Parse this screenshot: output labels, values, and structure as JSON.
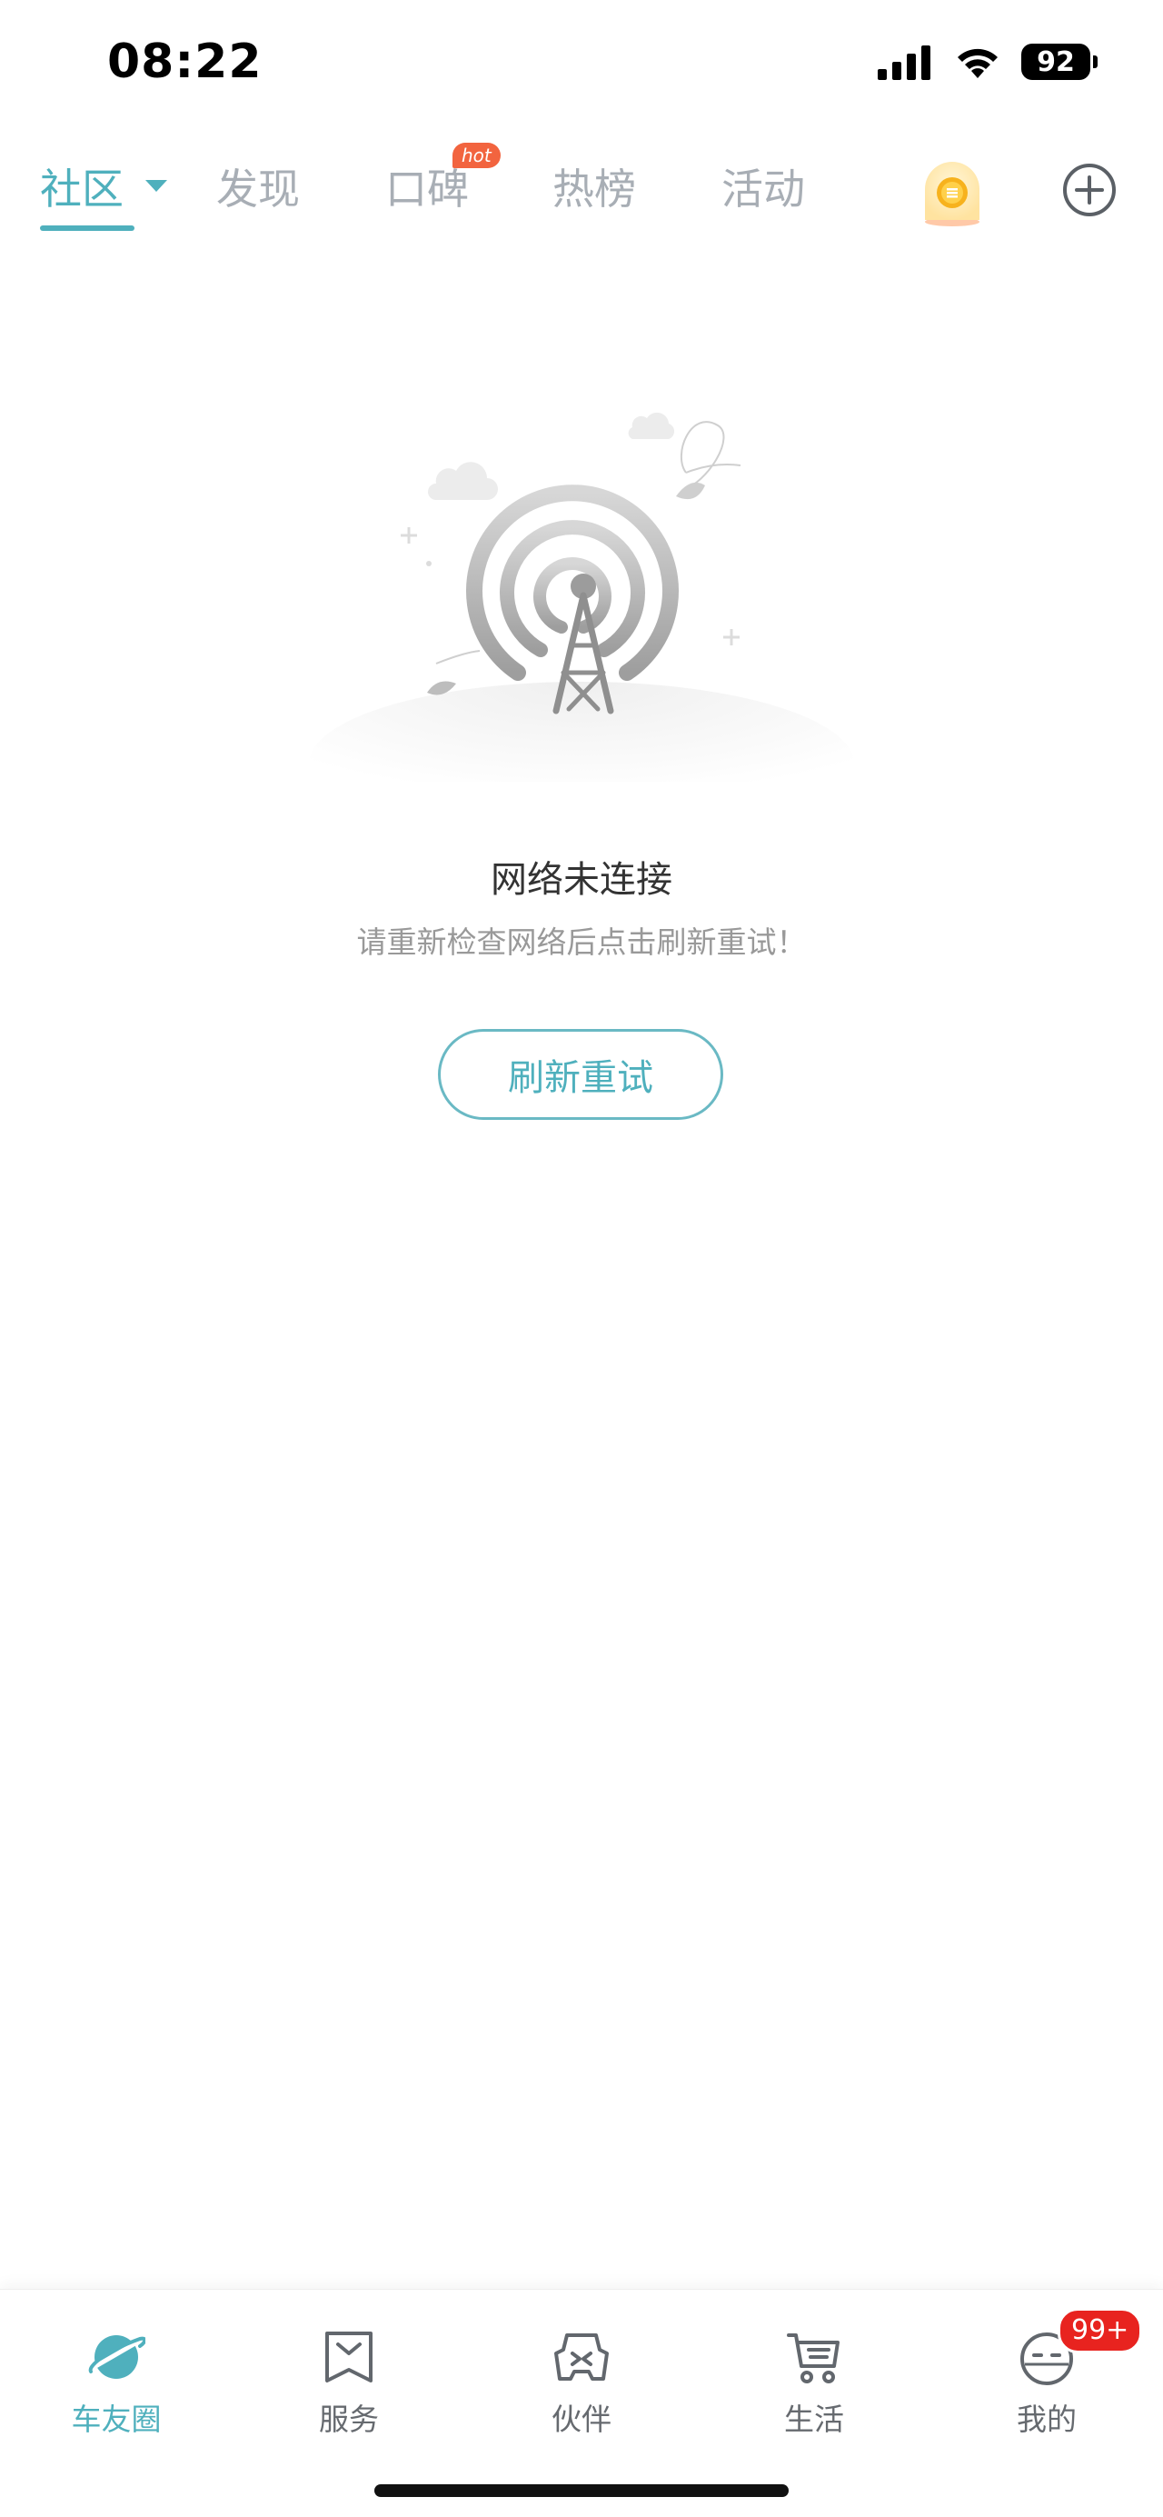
{
  "status_bar": {
    "time": "08:22",
    "battery": "92"
  },
  "top_tabs": {
    "items": [
      {
        "label": "社区",
        "active": true
      },
      {
        "label": "发现",
        "active": false
      },
      {
        "label": "口碑",
        "active": false,
        "badge": "hot"
      },
      {
        "label": "热榜",
        "active": false
      },
      {
        "label": "活动",
        "active": false
      }
    ],
    "hot_badge": "hot"
  },
  "empty_state": {
    "title": "网络未连接",
    "subtitle": "请重新检查网络后点击刷新重试！",
    "retry_label": "刷新重试"
  },
  "bottom_nav": {
    "items": [
      {
        "label": "车友圈",
        "icon": "planet-icon",
        "active": true
      },
      {
        "label": "服务",
        "icon": "bookmark-icon",
        "active": false
      },
      {
        "label": "伙伴",
        "icon": "gamepad-icon",
        "active": false
      },
      {
        "label": "生活",
        "icon": "cart-icon",
        "active": false
      },
      {
        "label": "我的",
        "icon": "face-icon",
        "active": false
      }
    ],
    "mine_badge": "99+"
  },
  "colors": {
    "accent": "#4fb0bd",
    "inactive_tab": "#a8aeb5",
    "badge_red": "#e8231f",
    "hot_orange": "#f2643f"
  }
}
